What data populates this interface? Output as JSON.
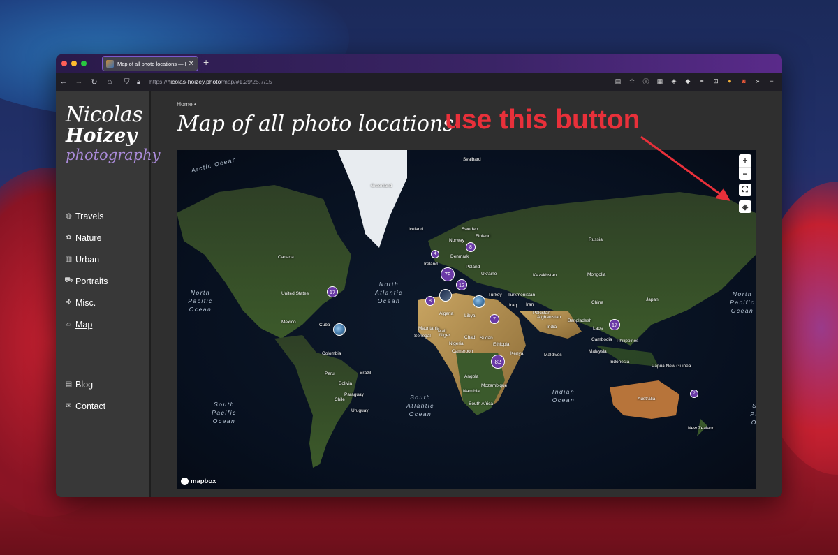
{
  "browser": {
    "tab_title": "Map of all photo locations — Nic",
    "url_prefix": "https://",
    "url_host": "nicolas-hoizey.photo",
    "url_path": "/map/#1.29/25.7/15",
    "traffic_lights": [
      "#ff5f57",
      "#febc2e",
      "#28c840"
    ]
  },
  "logo": {
    "line1": "Nicolas",
    "line2": "Hoizey",
    "line3": "photography"
  },
  "nav": {
    "main": [
      {
        "label": "Travels",
        "icon": "globe-icon"
      },
      {
        "label": "Nature",
        "icon": "flower-icon"
      },
      {
        "label": "Urban",
        "icon": "building-icon"
      },
      {
        "label": "Portraits",
        "icon": "car-icon"
      },
      {
        "label": "Misc.",
        "icon": "puzzle-icon"
      },
      {
        "label": "Map",
        "icon": "map-icon",
        "active": true
      }
    ],
    "secondary": [
      {
        "label": "Blog",
        "icon": "newspaper-icon"
      },
      {
        "label": "Contact",
        "icon": "envelope-icon"
      }
    ]
  },
  "breadcrumb": "Home •",
  "page_title": "Map of all photo locations",
  "annotation": "use this button",
  "map": {
    "attribution": "mapbox",
    "ocean_labels": [
      {
        "text": "Arctic Ocean"
      },
      {
        "text": "North Pacific Ocean"
      },
      {
        "text": "North Atlantic Ocean"
      },
      {
        "text": "South Pacific Ocean"
      },
      {
        "text": "South Atlantic Ocean"
      },
      {
        "text": "Indian Ocean"
      },
      {
        "text": "North Pacific Ocean"
      },
      {
        "text": "South Pacific Ocean"
      }
    ],
    "countries": [
      "Greenland",
      "Svalbard",
      "Iceland",
      "Sweden",
      "Finland",
      "Norway",
      "Russia",
      "Denmark",
      "Ireland",
      "Poland",
      "Ukraine",
      "Kazakhstan",
      "Mongolia",
      "Canada",
      "United States",
      "Mexico",
      "Cuba",
      "Turkey",
      "Turkmenistan",
      "China",
      "Japan",
      "Algeria",
      "Libya",
      "Iraq",
      "Iran",
      "Afghanistan",
      "Pakistan",
      "India",
      "Bangladesh",
      "Laos",
      "Mauritania",
      "Mali",
      "Niger",
      "Chad",
      "Sudan",
      "Senegal",
      "Nigeria",
      "Ethiopia",
      "Cameroon",
      "Kenya",
      "Philippines",
      "Cambodia",
      "Malaysia",
      "Maldives",
      "Indonesia",
      "Papua New Guinea",
      "Colombia",
      "Peru",
      "Brazil",
      "Bolivia",
      "Paraguay",
      "Chile",
      "Uruguay",
      "Angola",
      "Mozambique",
      "Namibia",
      "South Africa",
      "Australia",
      "New Zealand"
    ],
    "clusters": [
      "17",
      "4",
      "8",
      "79",
      "12",
      "8",
      "7",
      "82",
      "17",
      "2"
    ],
    "controls": {
      "zoom_in": "+",
      "zoom_out": "−"
    }
  }
}
